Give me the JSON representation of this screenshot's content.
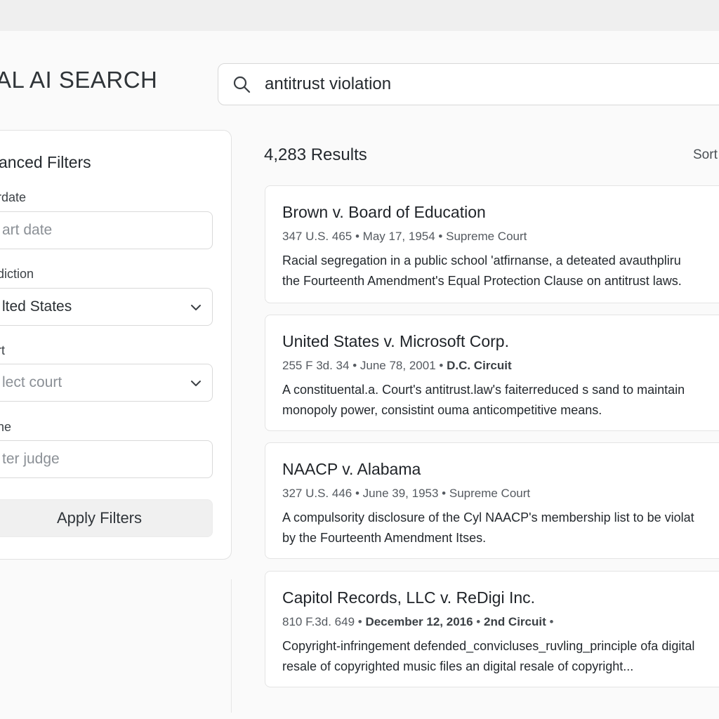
{
  "app": {
    "title": "AL AI SEARCH"
  },
  "search": {
    "value": "antitrust violation",
    "icon": "search-icon"
  },
  "filters": {
    "title": "anced Filters",
    "date": {
      "label": "rdate",
      "placeholder": "art date"
    },
    "jurisdiction": {
      "label": "diction",
      "value": "lted States"
    },
    "court": {
      "label": "rt",
      "placeholder": "lect court"
    },
    "judge": {
      "label": "ne",
      "placeholder": "ter judge"
    },
    "apply_label": "Apply Filters"
  },
  "results": {
    "count_label": "4,283 Results",
    "sort_label": "Sort",
    "items": [
      {
        "title": "Brown v. Board of Education",
        "citation": "347 U.S. 465",
        "date": "May 17, 1954",
        "court": "Supreme Court",
        "snippet_1": "Racial segregation in a public school 'atfirnanse, a deteated avauthpliru",
        "snippet_2": "the Fourteenth Amendment's Equal Protection Clause on antitrust laws."
      },
      {
        "title": "United States v. Microsoft Corp.",
        "citation": "255 F 3d. 34",
        "date": "June 78, 2001",
        "court": "D.C. Circuit",
        "snippet_1": "A constituental.a. Court's antitrust.law's faiterreduced s sand to maintain",
        "snippet_2": "monopoly power, consistint ouma anticompetitive means."
      },
      {
        "title": "NAACP v. Alabama",
        "citation": "327 U.S. 446",
        "date": "June 39, 1953",
        "court": "Supreme Court",
        "snippet_1": "A compulsority disclosure of the Cyl NAACP's membership list to be violat",
        "snippet_2": "by the Fourteenth Amendment  Itses."
      },
      {
        "title": "Capitol Records, LLC v. ReDigi Inc.",
        "citation": "810 F.3d. 649",
        "date": "December 12, 2016",
        "court": "2nd Circuit",
        "snippet_1": "Copyright-infringement defended_convicluses_ruvling_principle ofa digital",
        "snippet_2": "resale of copyrighted music files an digital resale of copyright..."
      }
    ]
  }
}
